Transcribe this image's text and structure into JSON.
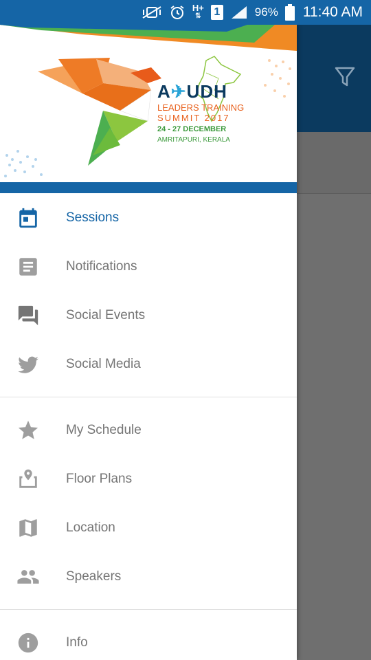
{
  "status_bar": {
    "network": "H+",
    "sim": "1",
    "battery": "96%",
    "time": "11:40 AM"
  },
  "banner": {
    "brand_a": "A",
    "brand_b": "UDH",
    "line1": "LEADERS TRAINING",
    "line2": "SUMMIT 2017",
    "line3": "24 - 27 DECEMBER",
    "line4": "AMRITAPURI, KERALA"
  },
  "menu": {
    "primary": [
      {
        "label": "Sessions",
        "icon": "calendar-icon",
        "active": true
      },
      {
        "label": "Notifications",
        "icon": "notes-icon"
      },
      {
        "label": "Social Events",
        "icon": "chat-icon"
      },
      {
        "label": "Social Media",
        "icon": "twitter-icon"
      }
    ],
    "secondary": [
      {
        "label": "My Schedule",
        "icon": "star-icon"
      },
      {
        "label": "Floor Plans",
        "icon": "map-pin-icon"
      },
      {
        "label": "Location",
        "icon": "map-icon"
      },
      {
        "label": "Speakers",
        "icon": "people-icon"
      }
    ],
    "tertiary": [
      {
        "label": "Info",
        "icon": "info-icon"
      }
    ]
  },
  "colors": {
    "primary": "#1565a6",
    "toolbar": "#0b3a5f",
    "active_text": "#1565a6",
    "inactive_text": "#757575",
    "icon_gray": "#9e9e9e"
  }
}
